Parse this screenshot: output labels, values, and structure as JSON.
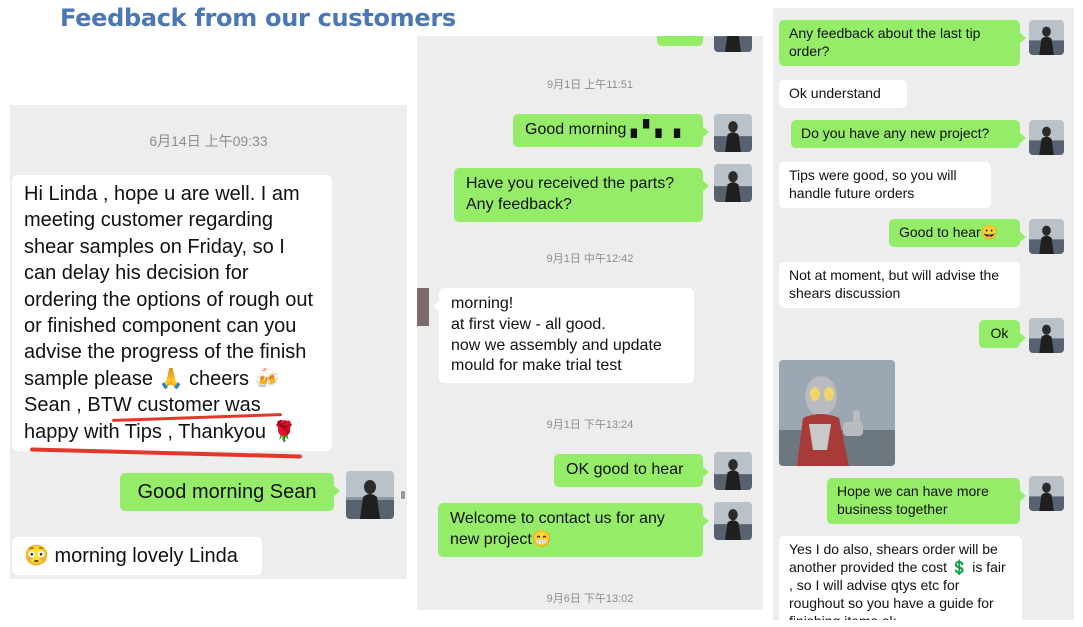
{
  "header": {
    "title": "Feedback from our customers"
  },
  "panel1": {
    "timestamp": "6月14日 上午09:33",
    "msg_customer": "Hi Linda , hope u are well. I am meeting customer regarding shear samples on Friday, so I can delay his decision for ordering the options of rough out or finished component can you advise the progress of the finish sample please 🙏 cheers 🍻 Sean , BTW customer was happy with Tips , Thankyou 🌹",
    "msg_reply": "Good morning Sean",
    "msg_customer2": "😳 morning lovely Linda"
  },
  "panel2": {
    "ts1": "9月1日 上午11:51",
    "msg1": "Good morning ▖▘▖▗",
    "msg2": "Have you received the parts? Any feedback?",
    "ts2": "9月1日 中午12:42",
    "msg3_lines": [
      "morning!",
      "at first view - all good.",
      "now we assembly and update",
      "mould for make trial test"
    ],
    "ts3": "9月1日 下午13:24",
    "msg4": "OK good to hear",
    "msg5": "Welcome to contact us for any new project😁",
    "ts4": "9月6日 下午13:02"
  },
  "panel3": {
    "msg1": "Any feedback about the last tip order?",
    "msg2": "Ok understand",
    "msg3": "Do you have any new project?",
    "msg4": "Tips were good, so you will handle future orders",
    "msg5": "Good to hear😀",
    "msg6": "Not at moment, but will advise the shears discussion",
    "msg7": "Ok",
    "msg8": "Hope we can have more business together",
    "msg9": "Yes I do also, shears order will be another provided the cost 💲 is fair , so I will advise qtys etc for roughout so you have a guide for finishing items ok"
  },
  "colors": {
    "title": "#4a78b4",
    "sent_bubble": "#95ec69",
    "received_bubble": "#ffffff",
    "chat_bg": "#ededed",
    "underline": "#e0392b"
  },
  "icons": {
    "avatar": "woman-by-sea-avatar",
    "image_message": "ultraman-thumbs-up-image"
  }
}
